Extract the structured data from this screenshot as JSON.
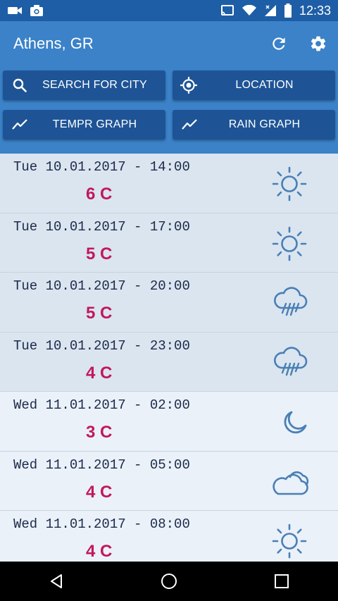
{
  "status_bar": {
    "time": "12:33"
  },
  "header": {
    "title": "Athens, GR",
    "buttons": {
      "search": "SEARCH FOR CITY",
      "location": "LOCATION",
      "temp_graph": "TEMPR GRAPH",
      "rain_graph": "RAIN GRAPH"
    }
  },
  "forecast": [
    {
      "date": "Tue 10.01.2017 - 14:00",
      "temp": "6 C",
      "icon": "sun-icon"
    },
    {
      "date": "Tue 10.01.2017 - 17:00",
      "temp": "5 C",
      "icon": "sun-icon"
    },
    {
      "date": "Tue 10.01.2017 - 20:00",
      "temp": "5 C",
      "icon": "rain-cloud-icon"
    },
    {
      "date": "Tue 10.01.2017 - 23:00",
      "temp": "4 C",
      "icon": "rain-cloud-icon"
    },
    {
      "date": "Wed 11.01.2017 - 02:00",
      "temp": "3 C",
      "icon": "moon-icon"
    },
    {
      "date": "Wed 11.01.2017 - 05:00",
      "temp": "4 C",
      "icon": "cloud-icon"
    },
    {
      "date": "Wed 11.01.2017 - 08:00",
      "temp": "4 C",
      "icon": "sun-icon"
    }
  ],
  "colors": {
    "header": "#3b82c8",
    "status_bar": "#1e5ea6",
    "button": "#1e5496",
    "temperature": "#c2185b",
    "icon": "#4a7fb5"
  }
}
